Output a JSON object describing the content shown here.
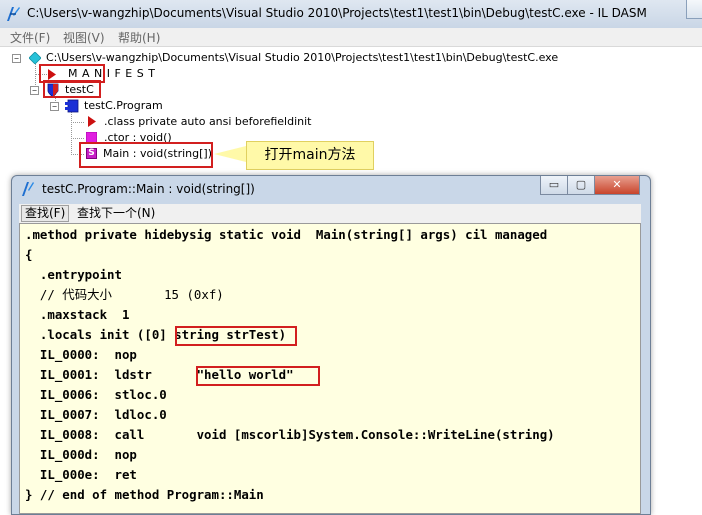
{
  "window": {
    "title": "C:\\Users\\v-wangzhip\\Documents\\Visual Studio 2010\\Projects\\test1\\test1\\bin\\Debug\\testC.exe - IL DASM"
  },
  "menu": [
    {
      "label": "文件(F)"
    },
    {
      "label": "视图(V)"
    },
    {
      "label": "帮助(H)"
    }
  ],
  "tree": {
    "root": "C:\\Users\\v-wangzhip\\Documents\\Visual Studio 2010\\Projects\\test1\\test1\\bin\\Debug\\testC.exe",
    "manifest": "M A N I F E S T",
    "namespace": "testC",
    "class": "testC.Program",
    "class_decl": ".class private auto ansi beforefieldinit",
    "ctor": ".ctor : void()",
    "main": "Main : void(string[])",
    "expand_minus": "−",
    "main_icon": "S"
  },
  "callout": {
    "text": "打开main方法"
  },
  "code_window": {
    "title": "testC.Program::Main : void(string[])",
    "toolbar": {
      "find": "查找(F)",
      "find_next": "查找下一个(N)"
    },
    "lines": [
      ".method private hidebysig static void  Main(string[] args) cil managed",
      "{",
      "  .entrypoint",
      "  // 代码大小       15 (0xf)",
      "  .maxstack  1",
      "  .locals init ([0] string strTest)",
      "  IL_0000:  nop",
      "  IL_0001:  ldstr      \"hello world\"",
      "  IL_0006:  stloc.0",
      "  IL_0007:  ldloc.0",
      "  IL_0008:  call       void [mscorlib]System.Console::WriteLine(string)",
      "  IL_000d:  nop",
      "  IL_000e:  ret",
      "} // end of method Program::Main"
    ],
    "buttons": {
      "minimize": "▭",
      "maximize": "▢",
      "close": "✕"
    }
  },
  "colors": {
    "highlight": "#d21f1f",
    "callout": "#fff9a8",
    "code_bg": "#ffffe1"
  },
  "icons": {
    "app": "il-dasm-icon",
    "assembly": "diamond-icon",
    "manifest": "triangle-icon",
    "namespace": "shield-icon",
    "class": "class-icon",
    "method": "method-icon",
    "static_method": "static-method-icon"
  }
}
